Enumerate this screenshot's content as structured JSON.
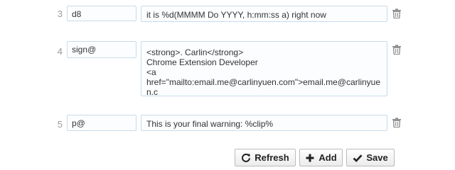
{
  "rows": [
    {
      "number": "3",
      "abbreviation": "d8",
      "text": "it is %d(MMMM Do YYYY, h:mm:ss a) right now",
      "delete_icon": "trash-icon"
    },
    {
      "number": "4",
      "abbreviation": "sign@",
      "text": "<strong>. Carlin</strong>\nChrome Extension Developer\n<a\nhref=\"mailto:email.me@carlinyuen.com\">email.me@carlinyuen.c\nom</a>",
      "delete_icon": "trash-icon"
    },
    {
      "number": "5",
      "abbreviation": "p@",
      "text": "This is your final warning: %clip%",
      "delete_icon": "trash-icon"
    }
  ],
  "toolbar": {
    "refresh_label": "Refresh",
    "refresh_icon": "refresh-icon",
    "add_label": "Add",
    "add_icon": "plus-icon",
    "save_label": "Save",
    "save_icon": "checkmark-icon"
  }
}
